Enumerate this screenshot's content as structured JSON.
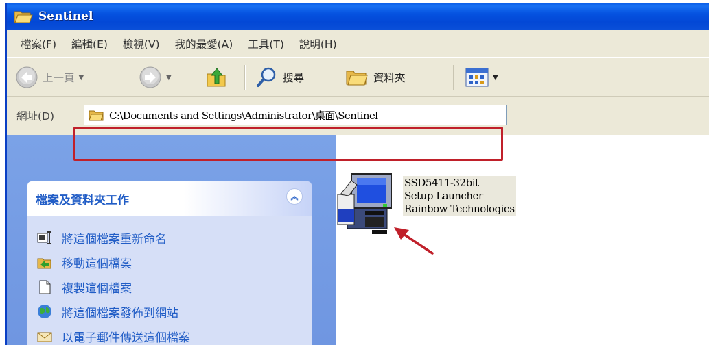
{
  "window": {
    "title": "Sentinel"
  },
  "menubar": {
    "items": [
      "檔案(F)",
      "編輯(E)",
      "檢視(V)",
      "我的最愛(A)",
      "工具(T)",
      "說明(H)"
    ]
  },
  "toolbar": {
    "back_label": "上一頁",
    "search_label": "搜尋",
    "folders_label": "資料夾"
  },
  "addressbar": {
    "label": "網址(D)",
    "path": "C:\\Documents and Settings\\Administrator\\桌面\\Sentinel"
  },
  "task_panel": {
    "title": "檔案及資料夾工作",
    "items": [
      {
        "label": "將這個檔案重新命名",
        "icon": "rename-icon"
      },
      {
        "label": "移動這個檔案",
        "icon": "move-icon"
      },
      {
        "label": "複製這個檔案",
        "icon": "copy-icon"
      },
      {
        "label": "將這個檔案發佈到網站",
        "icon": "publish-web-icon"
      },
      {
        "label": "以電子郵件傳送這個檔案",
        "icon": "email-icon"
      }
    ]
  },
  "file": {
    "name": "SSD5411-32bit",
    "description": "Setup Launcher",
    "company": "Rainbow Technologies",
    "icon": "setup-launcher-icon"
  },
  "colors": {
    "titlebar": "#0552e0",
    "highlight": "#c0202a",
    "task_link": "#215dc6",
    "left_pane": "#7ba2e7"
  }
}
